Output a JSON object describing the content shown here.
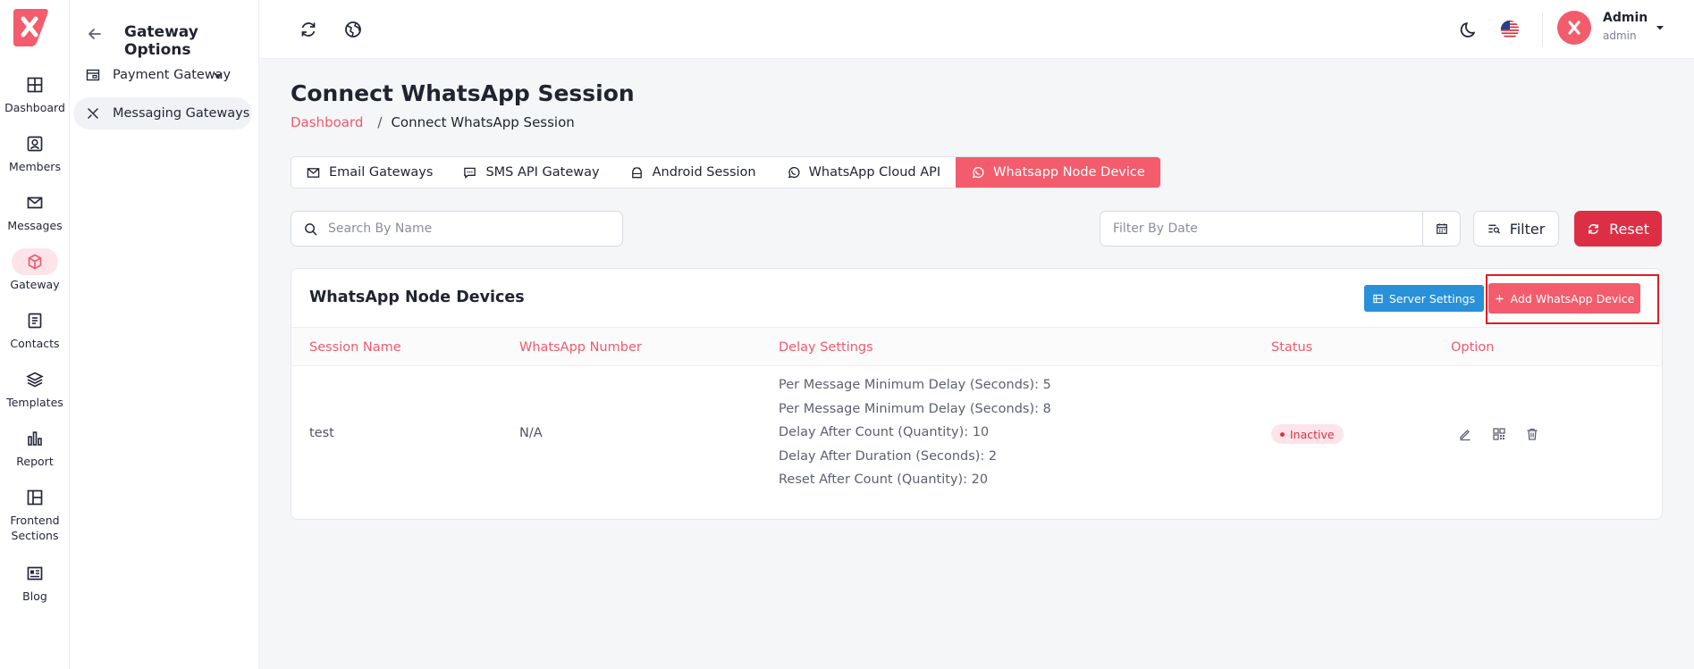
{
  "rail": {
    "items": [
      {
        "label": "Dashboard",
        "icon": "grid-icon"
      },
      {
        "label": "Members",
        "icon": "user-square-icon"
      },
      {
        "label": "Messages",
        "icon": "mail-send-icon"
      },
      {
        "label": "Gateway",
        "icon": "cube-icon"
      },
      {
        "label": "Contacts",
        "icon": "contacts-icon"
      },
      {
        "label": "Templates",
        "icon": "layers-icon"
      },
      {
        "label": "Report",
        "icon": "bar-chart-icon"
      },
      {
        "label": "Frontend Sections",
        "icon": "layout-icon"
      },
      {
        "label": "Blog",
        "icon": "newspaper-icon"
      }
    ]
  },
  "subnav": {
    "title": "Gateway Options",
    "items": [
      {
        "label": "Payment Gateway"
      },
      {
        "label": "Messaging Gateways"
      }
    ]
  },
  "topbar": {
    "admin_name": "Admin",
    "admin_role": "admin"
  },
  "page": {
    "title": "Connect WhatsApp Session",
    "breadcrumb_link": "Dashboard",
    "breadcrumb_sep": "/",
    "breadcrumb_current": "Connect WhatsApp Session"
  },
  "tabs": [
    {
      "label": "Email Gateways"
    },
    {
      "label": "SMS API Gateway"
    },
    {
      "label": "Android Session"
    },
    {
      "label": "WhatsApp Cloud API"
    },
    {
      "label": "Whatsapp Node Device"
    }
  ],
  "filters": {
    "search_placeholder": "Search By Name",
    "date_placeholder": "Filter By Date",
    "filter_label": "Filter",
    "reset_label": "Reset"
  },
  "card": {
    "title": "WhatsApp Node Devices",
    "server_settings_label": "Server Settings",
    "add_device_label": "Add WhatsApp Device",
    "columns": [
      "Session Name",
      "WhatsApp Number",
      "Delay Settings",
      "Status",
      "Option"
    ],
    "rows": [
      {
        "session_name": "test",
        "whatsapp_number": "N/A",
        "delay_settings": [
          "Per Message Minimum Delay (Seconds): 5",
          "Per Message Minimum Delay (Seconds): 8",
          "Delay After Count (Quantity): 10",
          "Delay After Duration (Seconds): 2",
          "Reset After Count (Quantity): 20"
        ],
        "status": "Inactive"
      }
    ]
  },
  "colors": {
    "accent": "#f25c6c",
    "danger": "#dc2f45",
    "info": "#2891d8"
  }
}
